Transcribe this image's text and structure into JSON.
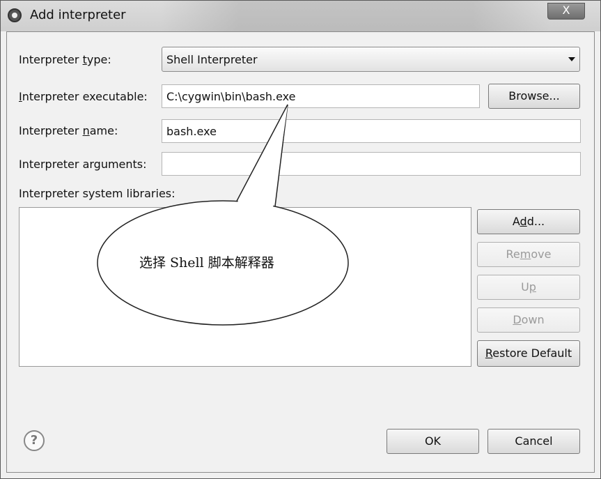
{
  "window": {
    "title": "Add interpreter",
    "close_label": "X"
  },
  "form": {
    "type_label_pre": "Interpreter ",
    "type_label_key": "t",
    "type_label_post": "ype:",
    "type_value": "Shell Interpreter",
    "exec_label_key": "I",
    "exec_label_post": "nterpreter executable:",
    "exec_value": "C:\\cygwin\\bin\\bash.exe",
    "browse_label": "Browse...",
    "name_label_pre": "Interpreter ",
    "name_label_key": "n",
    "name_label_post": "ame:",
    "name_value": "bash.exe",
    "args_label": "Interpreter arguments:",
    "args_value": "",
    "libs_label": "Interpreter system libraries:"
  },
  "libs_buttons": {
    "add_pre": "A",
    "add_key": "d",
    "add_post": "d...",
    "remove_pre": "Re",
    "remove_key": "m",
    "remove_post": "ove",
    "up_pre": "U",
    "up_key": "p",
    "down_key": "D",
    "down_post": "own",
    "restore_key": "R",
    "restore_post": "estore Default"
  },
  "footer": {
    "help_symbol": "?",
    "ok_label": "OK",
    "cancel_label": "Cancel"
  },
  "annotation": {
    "text": "选择 Shell 脚本解释器"
  },
  "colors": {
    "dialog_bg": "#f0f0f0",
    "field_bg": "#ffffff",
    "disabled_text": "#9a9a9a"
  }
}
